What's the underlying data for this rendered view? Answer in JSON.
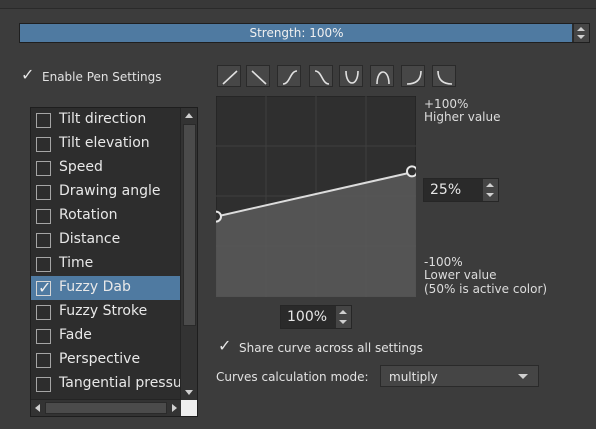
{
  "strength": {
    "label": "Strength: 100%",
    "value_percent": 100
  },
  "enable_pen": {
    "label": "Enable Pen Settings",
    "checked": true
  },
  "sensors": [
    {
      "label": "Tilt direction",
      "checked": false,
      "selected": false
    },
    {
      "label": "Tilt elevation",
      "checked": false,
      "selected": false
    },
    {
      "label": "Speed",
      "checked": false,
      "selected": false
    },
    {
      "label": "Drawing angle",
      "checked": false,
      "selected": false
    },
    {
      "label": "Rotation",
      "checked": false,
      "selected": false
    },
    {
      "label": "Distance",
      "checked": false,
      "selected": false
    },
    {
      "label": "Time",
      "checked": false,
      "selected": false
    },
    {
      "label": "Fuzzy Dab",
      "checked": true,
      "selected": true
    },
    {
      "label": "Fuzzy Stroke",
      "checked": false,
      "selected": false
    },
    {
      "label": "Fade",
      "checked": false,
      "selected": false
    },
    {
      "label": "Perspective",
      "checked": false,
      "selected": false
    },
    {
      "label": "Tangential pressure",
      "checked": false,
      "selected": false
    }
  ],
  "presets": [
    "curve-linear-icon",
    "curve-reverse-linear-icon",
    "curve-s-icon",
    "curve-reverse-s-icon",
    "curve-j-icon",
    "curve-l-icon",
    "curve-arch-icon",
    "curve-reverse-arch-icon"
  ],
  "curve": {
    "start": [
      0,
      0.4
    ],
    "end": [
      1,
      0.625
    ]
  },
  "side": {
    "top_value": "+100%",
    "top_desc": "Higher value",
    "bottom_value": "-100%",
    "bottom_desc": "Lower value",
    "bottom_note": "(50% is active color)"
  },
  "y_spin": {
    "value": "25%"
  },
  "x_spin": {
    "value": "100%"
  },
  "share_curve": {
    "label": "Share curve across all settings",
    "checked": true
  },
  "calc_mode": {
    "label": "Curves calculation mode:",
    "value": "multiply"
  }
}
